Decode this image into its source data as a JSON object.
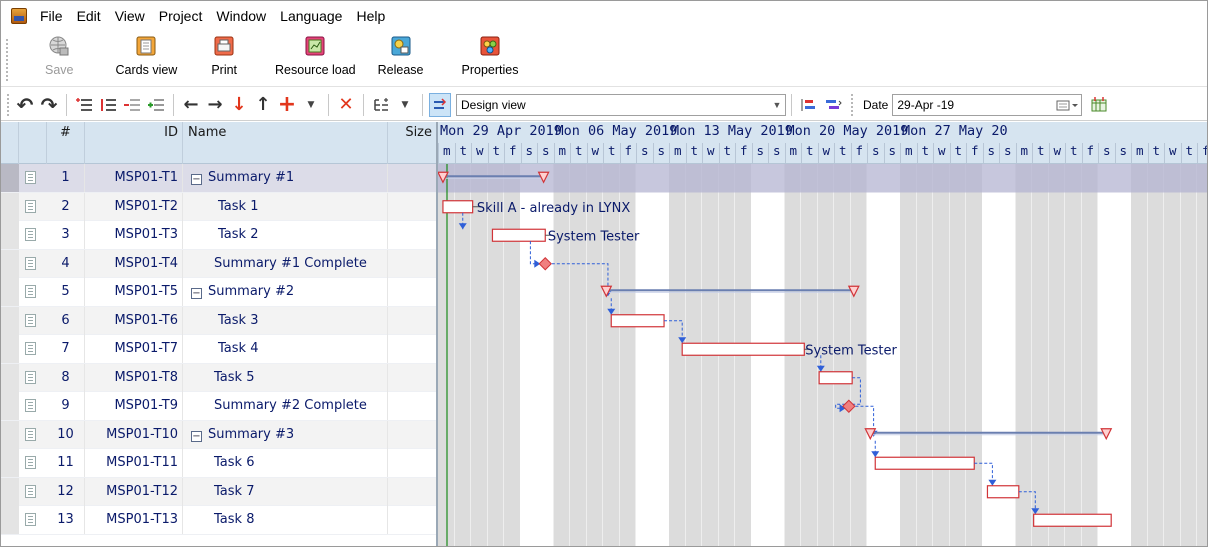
{
  "menu": [
    "File",
    "Edit",
    "View",
    "Project",
    "Window",
    "Language",
    "Help"
  ],
  "big_toolbar": [
    {
      "label": "Save",
      "icon": "save-globe-icon",
      "disabled": true
    },
    {
      "label": "Cards view",
      "icon": "cards-view-icon"
    },
    {
      "label": "Print",
      "icon": "printer-icon"
    },
    {
      "label": "Resource load",
      "icon": "resource-load-icon"
    },
    {
      "label": "Release",
      "icon": "release-icon"
    },
    {
      "label": "Properties",
      "icon": "properties-icon"
    }
  ],
  "view_select": "Design view",
  "date_label": "Date",
  "date_value": "29-Apr -19",
  "table_headers": {
    "num": "#",
    "id": "ID",
    "name": "Name",
    "size": "Size"
  },
  "weeks": [
    "Mon 29 Apr 2019",
    "Mon 06 May 2019",
    "Mon 13 May 2019",
    "Mon 20 May 2019",
    "Mon 27 May 20"
  ],
  "day_letters": [
    "m",
    "t",
    "w",
    "t",
    "f",
    "s",
    "s"
  ],
  "rows": [
    {
      "num": "1",
      "id": "MSP01-T1",
      "name": "Summary #1",
      "type": "summary"
    },
    {
      "num": "2",
      "id": "MSP01-T2",
      "name": "Task 1",
      "type": "task"
    },
    {
      "num": "3",
      "id": "MSP01-T3",
      "name": "Task 2",
      "type": "task"
    },
    {
      "num": "4",
      "id": "MSP01-T4",
      "name": "Summary #1 Complete",
      "type": "milestone"
    },
    {
      "num": "5",
      "id": "MSP01-T5",
      "name": "Summary #2",
      "type": "summary"
    },
    {
      "num": "6",
      "id": "MSP01-T6",
      "name": "Task 3",
      "type": "task"
    },
    {
      "num": "7",
      "id": "MSP01-T7",
      "name": "Task 4",
      "type": "task"
    },
    {
      "num": "8",
      "id": "MSP01-T8",
      "name": "Task 5",
      "type": "task"
    },
    {
      "num": "9",
      "id": "MSP01-T9",
      "name": "Summary #2 Complete",
      "type": "milestone"
    },
    {
      "num": "10",
      "id": "MSP01-T10",
      "name": "Summary #3",
      "type": "summary"
    },
    {
      "num": "11",
      "id": "MSP01-T11",
      "name": "Task 6",
      "type": "task"
    },
    {
      "num": "12",
      "id": "MSP01-T12",
      "name": "Task 7",
      "type": "task"
    },
    {
      "num": "13",
      "id": "MSP01-T13",
      "name": "Task 8",
      "type": "task"
    }
  ],
  "bar_labels": {
    "t2": "Skill A - already in LYNX",
    "t3": "System Tester",
    "t7": "System Tester"
  },
  "colors": {
    "header": "#d6e4f0",
    "bar_border": "#d13438",
    "link": "#2f5fd8",
    "weekend": "#dcdcdc"
  }
}
